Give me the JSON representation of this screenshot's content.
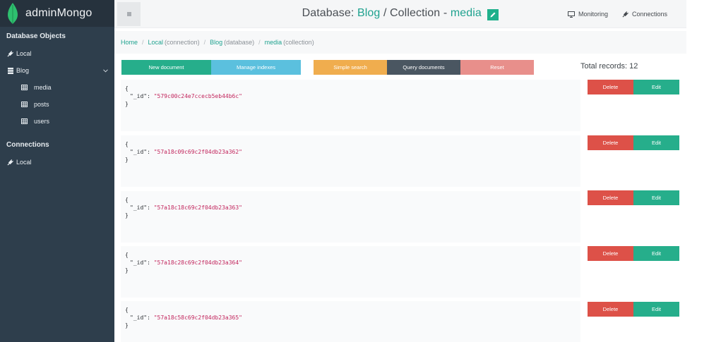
{
  "app": {
    "brand": "adminMongo",
    "brand_color": "#2ec06f"
  },
  "sidebar": {
    "db_heading": "Database Objects",
    "connections_heading": "Connections",
    "items": [
      {
        "label": "Local",
        "icon": "plug-icon"
      },
      {
        "label": "Blog",
        "icon": "database-icon"
      },
      {
        "label": "media",
        "icon": "table-icon"
      },
      {
        "label": "posts",
        "icon": "table-icon"
      },
      {
        "label": "users",
        "icon": "table-icon"
      }
    ],
    "connection_items": [
      {
        "label": "Local",
        "icon": "plug-icon"
      }
    ]
  },
  "header": {
    "prefix": "Database:",
    "db": "Blog",
    "mid": "/ Collection -",
    "collection": "media",
    "monitoring": "Monitoring",
    "connections": "Connections"
  },
  "breadcrumb": {
    "home": "Home",
    "local": "Local",
    "local_note": "(connection)",
    "blog": "Blog",
    "blog_note": "(database)",
    "media": "media",
    "media_note": "(collection)"
  },
  "toolbar": {
    "new_document": "New document",
    "manage_indexes": "Manage indexes",
    "simple_search": "Simple search",
    "query_documents": "Query documents",
    "reset": "Reset"
  },
  "total_records": "Total records: 12",
  "documents": [
    {
      "open": "{",
      "key": "\"_id\":",
      "value": "\"579c00c24e7ccecb5eb44b6c\"",
      "close": "}"
    },
    {
      "open": "{",
      "key": "\"_id\":",
      "value": "\"57a18c09c69c2f04db23a362\"",
      "close": "}"
    },
    {
      "open": "{",
      "key": "\"_id\":",
      "value": "\"57a18c18c69c2f04db23a363\"",
      "close": "}"
    },
    {
      "open": "{",
      "key": "\"_id\":",
      "value": "\"57a18c28c69c2f04db23a364\"",
      "close": "}"
    },
    {
      "open": "{",
      "key": "\"_id\":",
      "value": "\"57a18c58c69c2f04db23a365\"",
      "close": "}"
    }
  ],
  "row_actions": {
    "delete": "Delete",
    "edit": "Edit"
  },
  "colors": {
    "sidebar": "#2e3e4c",
    "teal": "#1fa28f",
    "green": "#26ae8b",
    "blue": "#5bc0de",
    "orange": "#f0ad4e",
    "dark": "#4a5661",
    "red": "#dd5148",
    "salmon": "#e88f8b"
  }
}
